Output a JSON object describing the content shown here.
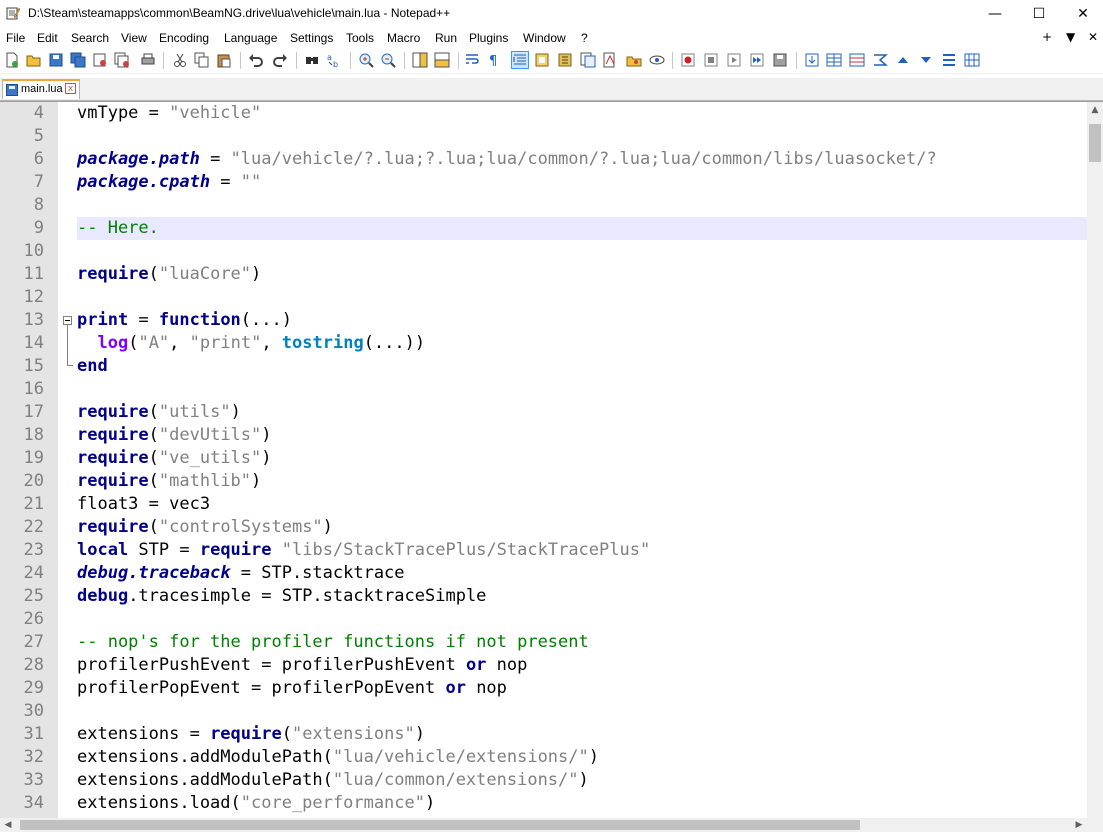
{
  "window": {
    "title": "D:\\Steam\\steamapps\\common\\BeamNG.drive\\lua\\vehicle\\main.lua - Notepad++",
    "minimize_glyph": "—",
    "maximize_glyph": "☐",
    "close_glyph": "✕"
  },
  "menu": {
    "items": [
      "File",
      "Edit",
      "Search",
      "View",
      "Encoding",
      "Language",
      "Settings",
      "Tools",
      "Macro",
      "Run",
      "Plugins",
      "Window",
      "?"
    ],
    "right": [
      "+",
      "▼",
      "✕"
    ]
  },
  "toolbar": {
    "icons": [
      "new-file-icon",
      "open-file-icon",
      "save-icon",
      "save-all-icon",
      "close-icon",
      "close-all-icon",
      "print-icon",
      "cut-icon",
      "copy-icon",
      "paste-icon",
      "undo-icon",
      "redo-icon",
      "find-icon",
      "replace-icon",
      "zoom-in-icon",
      "zoom-out-icon",
      "sync-vertical-icon",
      "sync-horizontal-icon",
      "word-wrap-icon",
      "show-all-chars-icon",
      "indent-guide-icon",
      "doc-map-icon",
      "function-list-icon",
      "folder-workspace-icon",
      "monitoring-icon",
      "doc-switcher-icon",
      "preview-icon",
      "record-macro-icon",
      "stop-macro-icon",
      "play-macro-icon",
      "run-macro-multiple-icon",
      "save-macro-icon",
      "plugin-1-icon",
      "plugin-2-icon",
      "plugin-3-icon",
      "plugin-4-icon",
      "up-arrow-icon",
      "down-arrow-icon",
      "plugin-5-icon",
      "plugin-6-icon"
    ]
  },
  "tab": {
    "label": "main.lua",
    "close_glyph": "x"
  },
  "editor": {
    "line_numbers": [
      "4",
      "5",
      "6",
      "7",
      "8",
      "9",
      "10",
      "11",
      "12",
      "13",
      "14",
      "15",
      "16",
      "17",
      "18",
      "19",
      "20",
      "21",
      "22",
      "23",
      "24",
      "25",
      "26",
      "27",
      "28",
      "29",
      "30",
      "31",
      "32",
      "33",
      "34"
    ],
    "highlighted_line": "9",
    "lines": [
      [
        [
          "t",
          "vmType = "
        ],
        [
          "str",
          "\"vehicle\""
        ]
      ],
      [],
      [
        [
          "lib",
          "package.path"
        ],
        [
          "t",
          " = "
        ],
        [
          "str",
          "\"lua/vehicle/?.lua;?.lua;lua/common/?.lua;lua/common/libs/luasocket/?"
        ]
      ],
      [
        [
          "lib",
          "package.cpath"
        ],
        [
          "t",
          " = "
        ],
        [
          "str",
          "\"\""
        ]
      ],
      [],
      [
        [
          "cmt",
          "-- Here."
        ]
      ],
      [],
      [
        [
          "kw",
          "require"
        ],
        [
          "t",
          "("
        ],
        [
          "str",
          "\"luaCore\""
        ],
        [
          "t",
          ")"
        ]
      ],
      [],
      [
        [
          "kw",
          "print"
        ],
        [
          "t",
          " = "
        ],
        [
          "kw",
          "function"
        ],
        [
          "t",
          "(...)"
        ]
      ],
      [
        [
          "t",
          "  "
        ],
        [
          "pur",
          "log"
        ],
        [
          "t",
          "("
        ],
        [
          "str",
          "\"A\""
        ],
        [
          "t",
          ", "
        ],
        [
          "str",
          "\"print\""
        ],
        [
          "t",
          ", "
        ],
        [
          "teal",
          "tostring"
        ],
        [
          "t",
          "(...))"
        ]
      ],
      [
        [
          "kw",
          "end"
        ]
      ],
      [],
      [
        [
          "kw",
          "require"
        ],
        [
          "t",
          "("
        ],
        [
          "str",
          "\"utils\""
        ],
        [
          "t",
          ")"
        ]
      ],
      [
        [
          "kw",
          "require"
        ],
        [
          "t",
          "("
        ],
        [
          "str",
          "\"devUtils\""
        ],
        [
          "t",
          ")"
        ]
      ],
      [
        [
          "kw",
          "require"
        ],
        [
          "t",
          "("
        ],
        [
          "str",
          "\"ve_utils\""
        ],
        [
          "t",
          ")"
        ]
      ],
      [
        [
          "kw",
          "require"
        ],
        [
          "t",
          "("
        ],
        [
          "str",
          "\"mathlib\""
        ],
        [
          "t",
          ")"
        ]
      ],
      [
        [
          "t",
          "float3 = vec3"
        ]
      ],
      [
        [
          "kw",
          "require"
        ],
        [
          "t",
          "("
        ],
        [
          "str",
          "\"controlSystems\""
        ],
        [
          "t",
          ")"
        ]
      ],
      [
        [
          "kw",
          "local"
        ],
        [
          "t",
          " STP = "
        ],
        [
          "kw",
          "require"
        ],
        [
          "t",
          " "
        ],
        [
          "str",
          "\"libs/StackTracePlus/StackTracePlus\""
        ]
      ],
      [
        [
          "lib",
          "debug.traceback"
        ],
        [
          "t",
          " = STP.stacktrace"
        ]
      ],
      [
        [
          "kw",
          "debug"
        ],
        [
          "t",
          ".tracesimple = STP.stacktraceSimple"
        ]
      ],
      [],
      [
        [
          "cmt",
          "-- nop's for the profiler functions if not present"
        ]
      ],
      [
        [
          "t",
          "profilerPushEvent = profilerPushEvent "
        ],
        [
          "kw",
          "or"
        ],
        [
          "t",
          " nop"
        ]
      ],
      [
        [
          "t",
          "profilerPopEvent = profilerPopEvent "
        ],
        [
          "kw",
          "or"
        ],
        [
          "t",
          " nop"
        ]
      ],
      [],
      [
        [
          "t",
          "extensions = "
        ],
        [
          "kw",
          "require"
        ],
        [
          "t",
          "("
        ],
        [
          "str",
          "\"extensions\""
        ],
        [
          "t",
          ")"
        ]
      ],
      [
        [
          "t",
          "extensions.addModulePath("
        ],
        [
          "str",
          "\"lua/vehicle/extensions/\""
        ],
        [
          "t",
          ")"
        ]
      ],
      [
        [
          "t",
          "extensions.addModulePath("
        ],
        [
          "str",
          "\"lua/common/extensions/\""
        ],
        [
          "t",
          ")"
        ]
      ],
      [
        [
          "t",
          "extensions.load("
        ],
        [
          "str",
          "\"core_performance\""
        ],
        [
          "t",
          ")"
        ]
      ]
    ]
  }
}
